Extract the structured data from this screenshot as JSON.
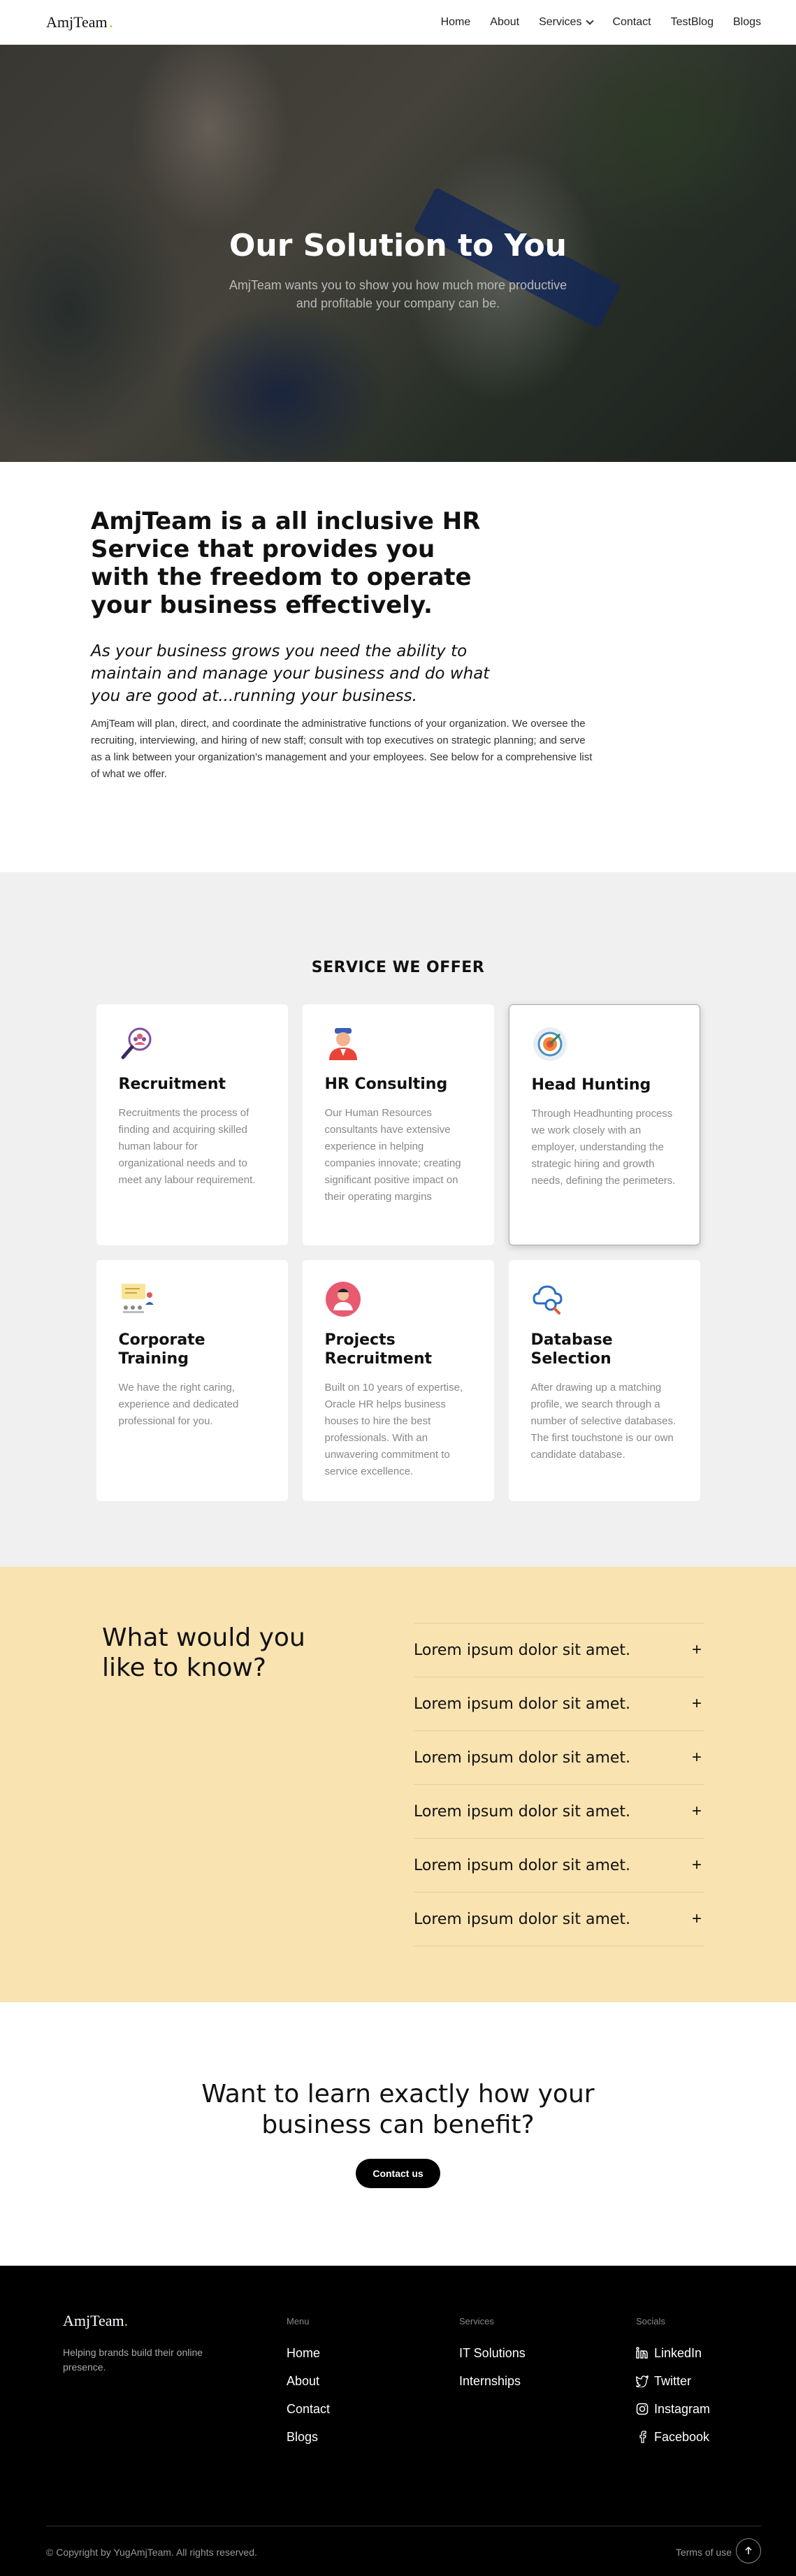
{
  "header": {
    "logo": "AmjTeam",
    "nav": [
      "Home",
      "About",
      "Services",
      "Contact",
      "TestBlog",
      "Blogs"
    ]
  },
  "hero": {
    "title": "Our Solution to You",
    "subtitle": "AmjTeam wants you to show you how much more productive and profitable your company can be."
  },
  "intro": {
    "heading": "AmjTeam is a all inclusive HR Service that provides you with the freedom to operate your business effectively.",
    "subheading": "As your business grows you need the ability to maintain and manage your business and do what you are good at...running your business.",
    "body": "AmjTeam will plan, direct, and coordinate the administrative functions of your organization. We oversee the recruiting, interviewing, and hiring of new staff; consult with top executives on strategic planning; and serve as a link between your organization's management and your employees. See below for a comprehensive list of what we offer."
  },
  "services": {
    "title": "SERVICE WE OFFER",
    "items": [
      {
        "name": "Recruitment",
        "desc": "Recruitments the process of finding and acquiring skilled human labour for organizational needs and to meet any labour requirement.",
        "icon": "recruitment-magnifier-icon"
      },
      {
        "name": "HR Consulting",
        "desc": "Our Human Resources consultants have extensive experience in helping companies innovate; creating significant positive impact on their operating margins",
        "icon": "consultant-person-icon"
      },
      {
        "name": "Head Hunting",
        "desc": "Through Headhunting process we work closely with an employer, understanding the strategic hiring and growth needs, defining the perimeters.",
        "icon": "target-icon"
      },
      {
        "name": "Corporate Training",
        "desc": "We have the right caring, experience and dedicated professional for you.",
        "icon": "training-board-icon"
      },
      {
        "name": "Projects Recruitment",
        "desc": "Built on 10 years of expertise, Oracle HR helps business houses to hire the best professionals. With an unwavering commitment to service excellence.",
        "icon": "candidate-avatar-icon"
      },
      {
        "name": "Database Selection",
        "desc": "After drawing up a matching profile, we search through a number of selective databases. The first touchstone is our own candidate database.",
        "icon": "cloud-search-icon"
      }
    ]
  },
  "faq": {
    "title": "What would you like to know?",
    "items": [
      "Lorem ipsum dolor sit amet.",
      "Lorem ipsum dolor sit amet.",
      "Lorem ipsum dolor sit amet.",
      "Lorem ipsum dolor sit amet.",
      "Lorem ipsum dolor sit amet.",
      "Lorem ipsum dolor sit amet."
    ],
    "plus": "+"
  },
  "cta": {
    "title": "Want to learn exactly how your business can benefit?",
    "button": "Contact us"
  },
  "footer": {
    "logo": "AmjTeam",
    "tagline": "Helping brands build their online presence.",
    "menu": {
      "caption": "Menu",
      "links": [
        "Home",
        "About",
        "Contact",
        "Blogs"
      ]
    },
    "services": {
      "caption": "Services",
      "links": [
        "IT Solutions",
        "Internships"
      ]
    },
    "socials": {
      "caption": "Socials",
      "links": [
        "LinkedIn",
        "Twitter",
        "Instagram",
        "Facebook"
      ]
    },
    "copyright": "Copyright by YugAmjTeam. All rights reserved.",
    "terms": "Terms of use"
  },
  "colors": {
    "accent_yellow": "#f9e3b0",
    "logo_dot": "#f2b705",
    "footer_bg": "#000000",
    "services_bg": "#f0f0f0"
  }
}
